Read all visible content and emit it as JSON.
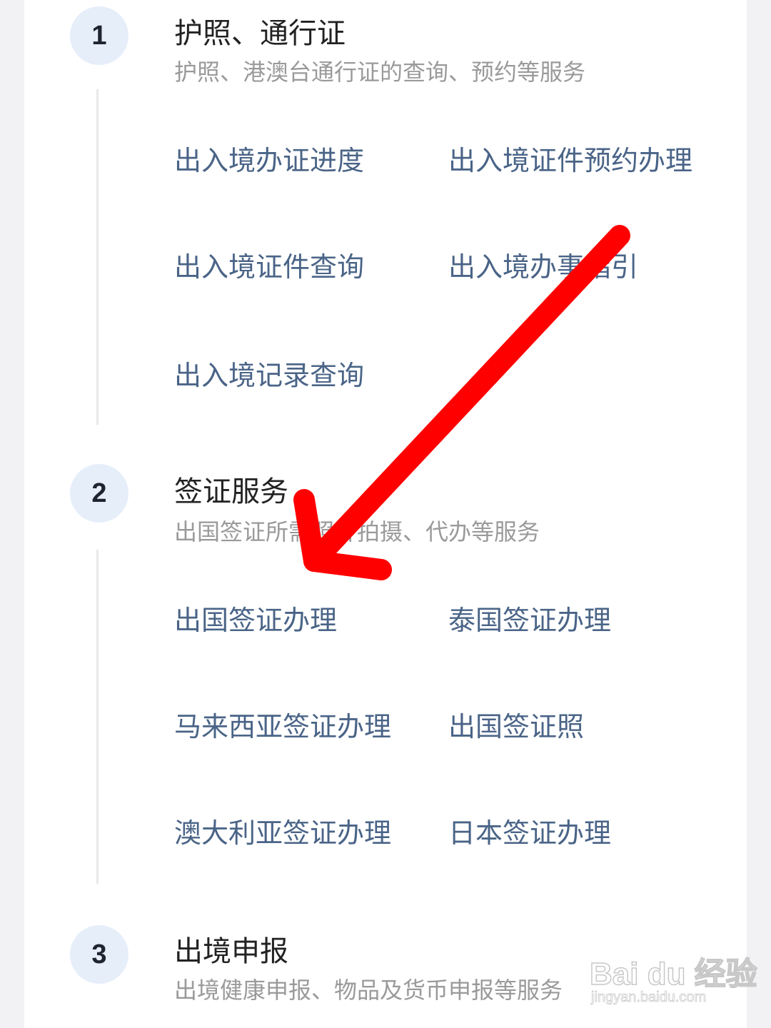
{
  "sections": [
    {
      "number": "1",
      "title": "护照、通行证",
      "subtitle": "护照、港澳台通行证的查询、预约等服务",
      "links": [
        "出入境办证进度",
        "出入境证件预约办理",
        "出入境证件查询",
        "出入境办事指引",
        "出入境记录查询"
      ]
    },
    {
      "number": "2",
      "title": "签证服务",
      "subtitle": "出国签证所需照片拍摄、代办等服务",
      "links": [
        "出国签证办理",
        "泰国签证办理",
        "马来西亚签证办理",
        "出国签证照",
        "澳大利亚签证办理",
        "日本签证办理"
      ]
    },
    {
      "number": "3",
      "title": "出境申报",
      "subtitle": "出境健康申报、物品及货币申报等服务"
    }
  ],
  "annotation": {
    "arrow_color": "#ff0000"
  },
  "watermark": {
    "brand": "Bai du 经验",
    "url": "jingyan.baidu.com"
  }
}
